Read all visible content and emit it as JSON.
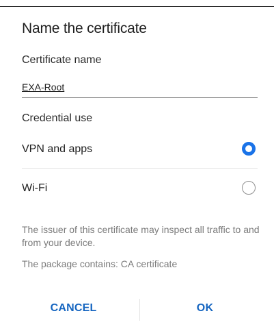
{
  "dialog": {
    "title": "Name the certificate",
    "certificate_name_label": "Certificate name",
    "certificate_name_value": "EXA-Root",
    "credential_use_label": "Credential use",
    "options": [
      {
        "label": "VPN and apps",
        "selected": true
      },
      {
        "label": "Wi-Fi",
        "selected": false
      }
    ],
    "info_warning": "The issuer of this certificate may inspect all traffic to and from your device.",
    "info_package": "The package contains: CA certificate",
    "cancel_label": "CANCEL",
    "ok_label": "OK"
  },
  "colors": {
    "accent": "#1a73e8",
    "button_text": "#1565c0",
    "secondary_text": "#7a7a7a"
  }
}
